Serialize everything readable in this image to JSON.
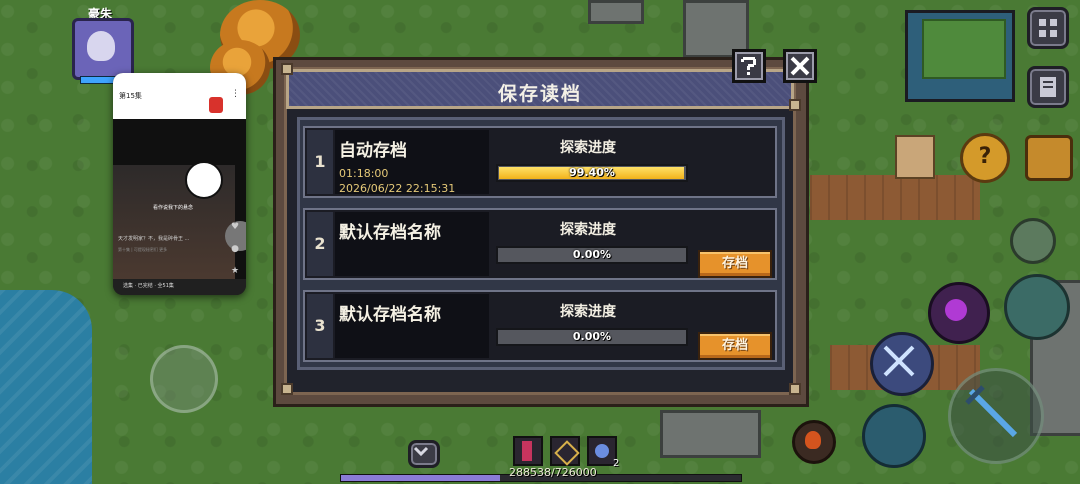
{
  "dialog": {
    "title": "保存读档",
    "help_label": "?",
    "close_label": "X"
  },
  "slots": [
    {
      "number": "1",
      "name": "自动存档",
      "time": "01:18:00",
      "date": "2026/06/22 22:15:31",
      "progress_label": "探索进度",
      "progress_text": "99.40%",
      "progress_fraction": 0.994,
      "save_button": ""
    },
    {
      "number": "2",
      "name": "默认存档名称",
      "time": "",
      "date": "",
      "progress_label": "探索进度",
      "progress_text": "0.00%",
      "progress_fraction": 0.0,
      "save_button": "存档"
    },
    {
      "number": "3",
      "name": "默认存档名称",
      "time": "",
      "date": "",
      "progress_label": "探索进度",
      "progress_text": "0.00%",
      "progress_fraction": 0.0,
      "save_button": "存档"
    }
  ],
  "hud": {
    "player_name": "豪朱",
    "xp_text": "288538/726000",
    "skill_count": "2"
  },
  "phone": {
    "episode": "第15集",
    "video_caption": "看作说我下的悬念",
    "line1": "天才发明家？不，我是碎骨王 ...",
    "line2": "第十集 | 可提现秘密们 更多",
    "line3": "选集 · 已完结 · 全51集"
  },
  "colors": {
    "accent_orange": "#e6922b",
    "progress_yellow": "#f2b21a",
    "title_bar": "#4b4f7a"
  }
}
